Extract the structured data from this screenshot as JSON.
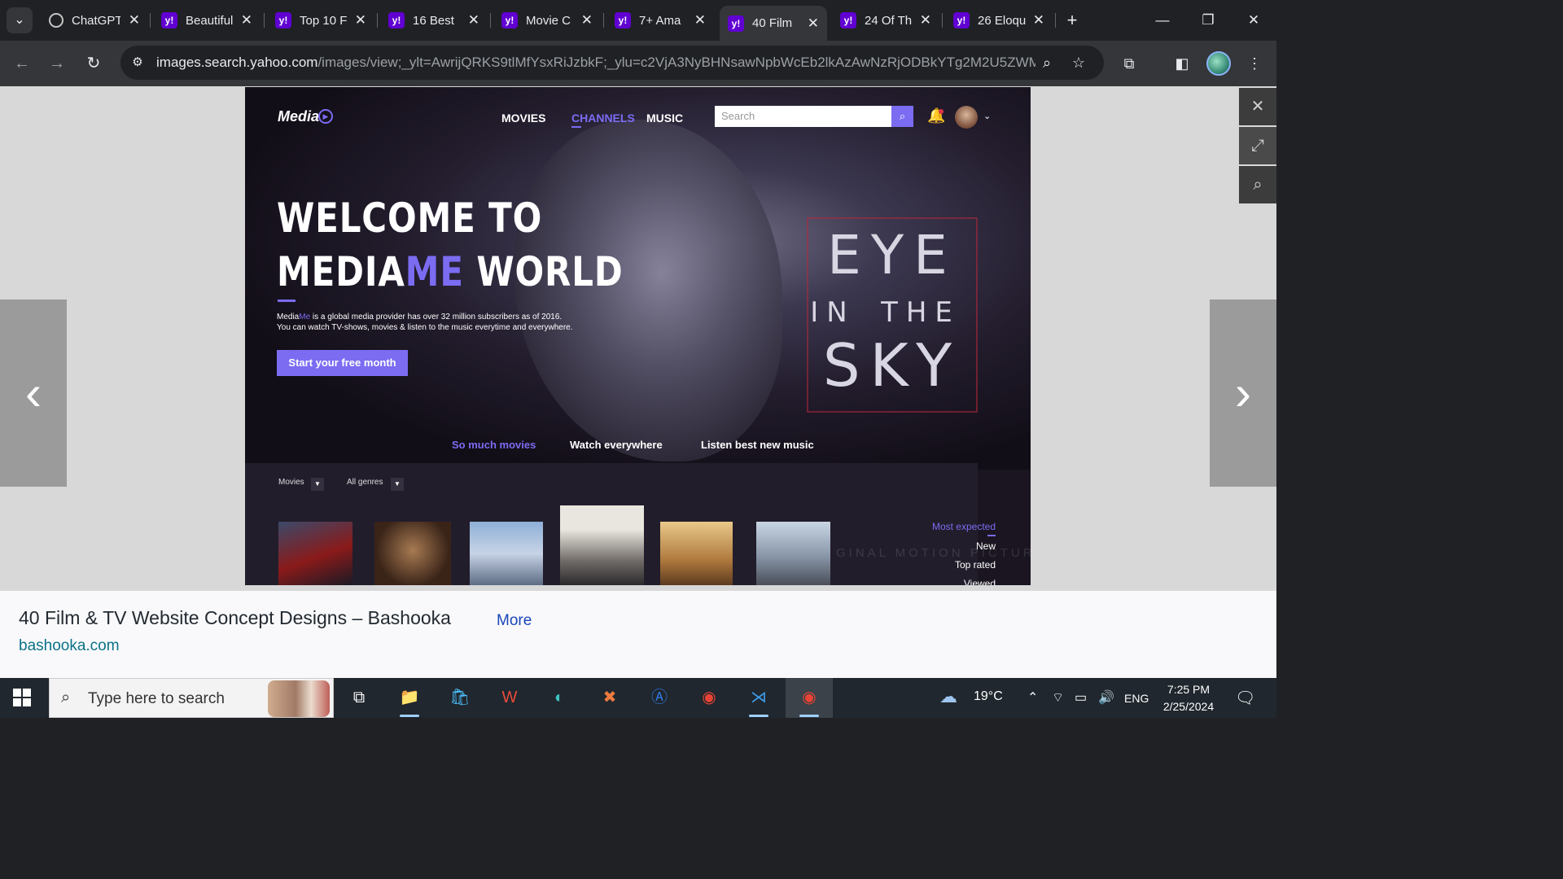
{
  "browser": {
    "tabs": [
      {
        "title": "ChatGPT",
        "icon": "chatgpt-icon"
      },
      {
        "title": "Beautiful",
        "icon": "yahoo-icon"
      },
      {
        "title": "Top 10 F",
        "icon": "yahoo-icon"
      },
      {
        "title": "16 Best",
        "icon": "yahoo-icon"
      },
      {
        "title": "Movie C",
        "icon": "yahoo-icon"
      },
      {
        "title": "7+ Ama",
        "icon": "yahoo-icon"
      },
      {
        "title": "40 Film",
        "icon": "yahoo-icon",
        "active": true
      },
      {
        "title": "24 Of Th",
        "icon": "yahoo-icon"
      },
      {
        "title": "26 Eloqu",
        "icon": "yahoo-icon"
      }
    ],
    "url_host": "images.search.yahoo.com",
    "url_path": "/images/view;_ylt=AwrijQRKS9tlMfYsxRiJzbkF;_ylu=c2VjA3NyBHNsawNpbWcEb2lkAzAwNzRjODBkYTg2M2U5ZWM..."
  },
  "preview": {
    "logo": "Media",
    "nav": [
      "MOVIES",
      "CHANNELS",
      "MUSIC"
    ],
    "search_placeholder": "Search",
    "headline_line1": "WELCOME TO",
    "headline_line2_a": "MEDIA",
    "headline_line2_b": "ME",
    "headline_line2_c": " WORLD",
    "desc_a": "Media",
    "desc_b": "Me",
    "desc_c": " is a global media provider has over 32 million subscribers as of 2016.",
    "desc_line2": "You can watch TV-shows, movies & listen to the music everytime and everywhere.",
    "cta": "Start your free month",
    "poster_title": [
      "EYE",
      "IN",
      "THE",
      "SKY"
    ],
    "features": [
      "So much movies",
      "Watch everywhere",
      "Listen best new music"
    ],
    "filters": [
      "Movies",
      "All genres"
    ],
    "sort": [
      "Most expected",
      "New",
      "Top rated",
      "Viewed"
    ],
    "watermark": "GINAL MOTION PICTURE SOUNDTRACK",
    "accent_color": "#7b6cf2"
  },
  "info": {
    "title": "40 Film & TV Website Concept Designs – Bashooka",
    "more": "More",
    "source": "bashooka.com"
  },
  "taskbar": {
    "search_placeholder": "Type here to search",
    "weather": "19°C",
    "language": "ENG",
    "time": "7:25 PM",
    "date": "2/25/2024"
  }
}
